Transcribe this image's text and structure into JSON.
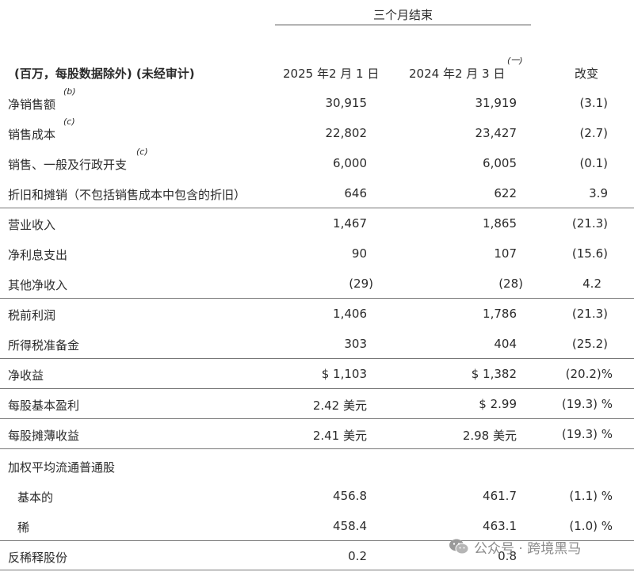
{
  "header": {
    "period_title": "三个月结束",
    "label_col": "(百万，每股数据除外) (未经审计)",
    "col1": "2025 年2 月 1 日",
    "col2": "2024 年2 月 3 日",
    "col2_note": "(一)",
    "col3": "改变"
  },
  "rows": [
    {
      "label": "净销售额",
      "note": "(b)",
      "v1": "30,915",
      "v2": "31,919",
      "v3": "(3.1)"
    },
    {
      "label": "销售成本",
      "note": "(c)",
      "v1": "22,802",
      "v2": "23,427",
      "v3": "(2.7)"
    },
    {
      "label": "销售、一般及行政开支",
      "note": "(c)",
      "v1": "6,000",
      "v2": "6,005",
      "v3": "(0.1)"
    },
    {
      "label": "折旧和摊销（不包括销售成本中包含的折旧）",
      "note": "",
      "v1": "646",
      "v2": "622",
      "v3": "3.9"
    },
    {
      "label": "营业收入",
      "note": "",
      "v1": "1,467",
      "v2": "1,865",
      "v3": "(21.3)"
    },
    {
      "label": "净利息支出",
      "note": "",
      "v1": "90",
      "v2": "107",
      "v3": "(15.6)"
    },
    {
      "label": "其他净收入",
      "note": "",
      "v1": "(29)",
      "v2": "(28)",
      "v3": "4.2"
    },
    {
      "label": "税前利润",
      "note": "",
      "v1": "1,406",
      "v2": "1,786",
      "v3": "(21.3)"
    },
    {
      "label": "所得税准备金",
      "note": "",
      "v1": "303",
      "v2": "404",
      "v3": "(25.2)"
    },
    {
      "label": "净收益",
      "note": "",
      "v1": "$ 1,103",
      "v2": "$ 1,382",
      "v3": "(20.2)%"
    },
    {
      "label": "每股基本盈利",
      "note": "",
      "v1": "2.42 美元",
      "v2": "$ 2.99",
      "v3": "(19.3) %"
    },
    {
      "label": "每股摊薄收益",
      "note": "",
      "v1": "2.41 美元",
      "v2": "2.98 美元",
      "v3": "(19.3) %"
    },
    {
      "label": "加权平均流通普通股",
      "note": "",
      "v1": "",
      "v2": "",
      "v3": ""
    },
    {
      "label": "基本的",
      "note": "",
      "v1": "456.8",
      "v2": "461.7",
      "v3": "(1.1)  %"
    },
    {
      "label": "稀",
      "note": "",
      "v1": "458.4",
      "v2": "463.1",
      "v3": "(1.0) %"
    },
    {
      "label": "反稀释股份",
      "note": "",
      "v1": "0.2",
      "v2": "0.8",
      "v3": ""
    }
  ],
  "watermark": {
    "text": "公众号 · 跨境黑马",
    "icon": "wechat-icon"
  }
}
